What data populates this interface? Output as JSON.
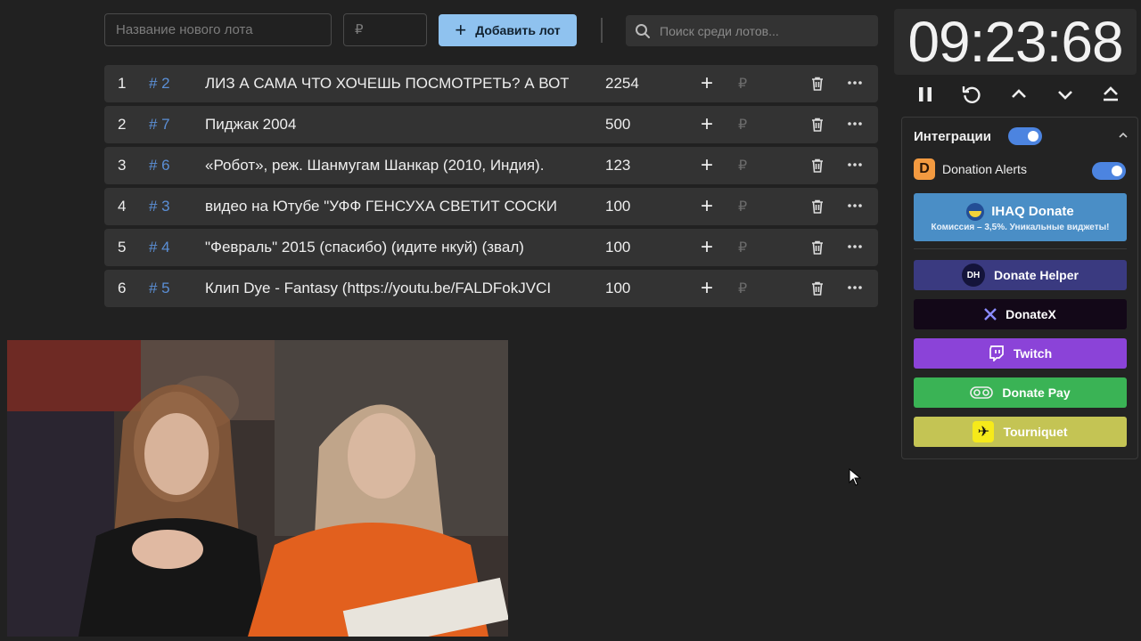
{
  "topbar": {
    "lot_name_placeholder": "Название нового лота",
    "price_placeholder": "₽",
    "add_lot_label": "Добавить лот",
    "search_placeholder": "Поиск среди лотов..."
  },
  "lots": [
    {
      "index": "1",
      "id": "# 2",
      "title": "ЛИЗ А САМА ЧТО ХОЧЕШЬ ПОСМОТРЕТЬ? А ВОТ",
      "amount": "2254",
      "currency": "₽"
    },
    {
      "index": "2",
      "id": "# 7",
      "title": "Пиджак 2004",
      "amount": "500",
      "currency": "₽"
    },
    {
      "index": "3",
      "id": "# 6",
      "title": "«Робот», реж. Шанмугам Шанкар (2010, Индия).",
      "amount": "123",
      "currency": "₽"
    },
    {
      "index": "4",
      "id": "# 3",
      "title": "видео на Ютубе \"УФФ ГЕНСУХА СВЕТИТ СОСКИ",
      "amount": "100",
      "currency": "₽"
    },
    {
      "index": "5",
      "id": "# 4",
      "title": "\"Февраль\" 2015 (спасибо) (идите нкуй) (звал)",
      "amount": "100",
      "currency": "₽"
    },
    {
      "index": "6",
      "id": "# 5",
      "title": "Клип Dye - Fantasy (https://youtu.be/FALDFokJVCI",
      "amount": "100",
      "currency": "₽"
    }
  ],
  "timer": {
    "value": "09:23:68"
  },
  "integrations": {
    "title": "Интеграции",
    "enabled": true,
    "donation_alerts": {
      "label": "Donation Alerts",
      "icon_letter": "D",
      "enabled": true
    },
    "services": [
      {
        "key": "ihaq",
        "label": "IHAQ Donate",
        "subtitle": "Комиссия – 3,5%. Уникальные виджеты!"
      },
      {
        "key": "dh",
        "label": "Donate Helper",
        "logo_text": "DH"
      },
      {
        "key": "dx",
        "label": "DonateX"
      },
      {
        "key": "tw",
        "label": "Twitch"
      },
      {
        "key": "dp",
        "label": "Donate Pay"
      },
      {
        "key": "tq",
        "label": "Tourniquet"
      }
    ]
  },
  "colors": {
    "accent": "#8fc2ef",
    "toggle": "#4c84e0",
    "id_blue": "#5b8fd6"
  }
}
